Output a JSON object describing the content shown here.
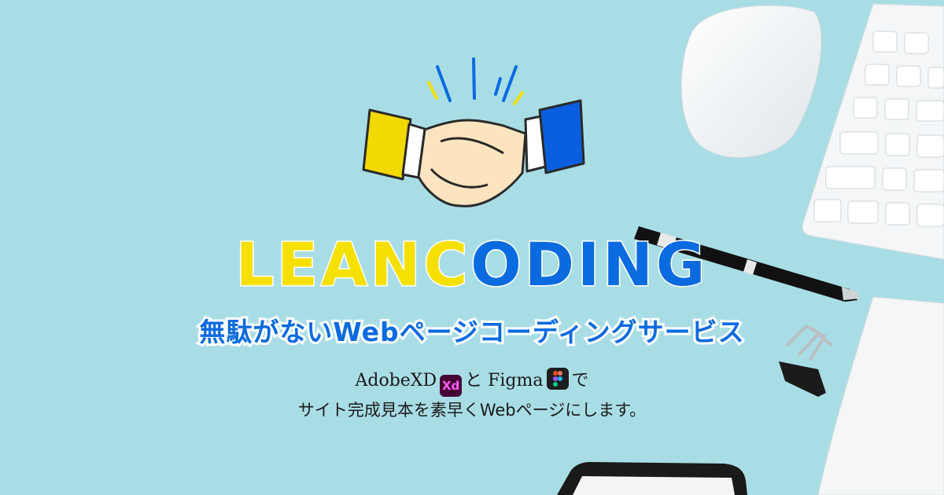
{
  "logo": {
    "part1": "LEAN",
    "part2": "C",
    "part3": "ODING"
  },
  "subtitle": "無駄がないWebページコーディングサービス",
  "description": {
    "app1": "AdobeXD",
    "app1_icon": "adobe-xd-icon",
    "app1_badge": "Xd",
    "connector": "と",
    "app2": "Figma",
    "app2_icon": "figma-icon",
    "tail": "で",
    "line2": "サイト完成見本を素早くWebページにします。"
  },
  "colors": {
    "background": "#a9dde6",
    "brand_blue": "#0a6be0",
    "brand_yellow": "#f5e000"
  }
}
